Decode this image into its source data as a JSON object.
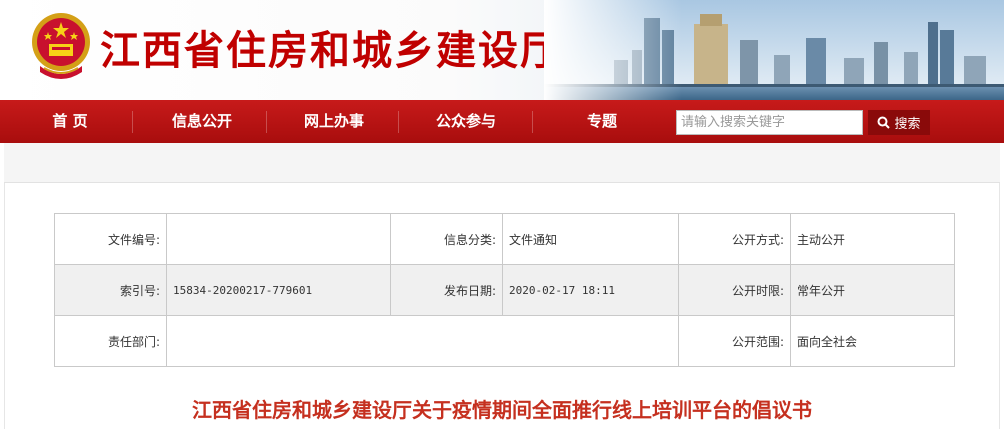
{
  "header": {
    "site_title": "江西省住房和城乡建设厅",
    "emblem_icon": "national-emblem-icon",
    "brand_color": "#c00000"
  },
  "nav": {
    "items": [
      {
        "label": "首  页"
      },
      {
        "label": "信息公开"
      },
      {
        "label": "网上办事"
      },
      {
        "label": "公众参与"
      },
      {
        "label": "专题"
      }
    ],
    "background_color": "#b81414"
  },
  "search": {
    "placeholder": "请输入搜索关键字",
    "value": "",
    "button_label": "搜索",
    "button_icon": "search-icon"
  },
  "meta": {
    "doc_number_label": "文件编号:",
    "doc_number_value": "",
    "category_label": "信息分类:",
    "category_value": "文件通知",
    "disclosure_method_label": "公开方式:",
    "disclosure_method_value": "主动公开",
    "index_label": "索引号:",
    "index_value": "15834-20200217-779601",
    "publish_date_label": "发布日期:",
    "publish_date_value": "2020-02-17 18:11",
    "disclosure_time_label": "公开时限:",
    "disclosure_time_value": "常年公开",
    "department_label": "责任部门:",
    "department_value": "",
    "disclosure_scope_label": "公开范围:",
    "disclosure_scope_value": "面向全社会"
  },
  "article": {
    "title": "江西省住房和城乡建设厅关于疫情期间全面推行线上培训平台的倡议书",
    "title_color": "#c5301f"
  }
}
